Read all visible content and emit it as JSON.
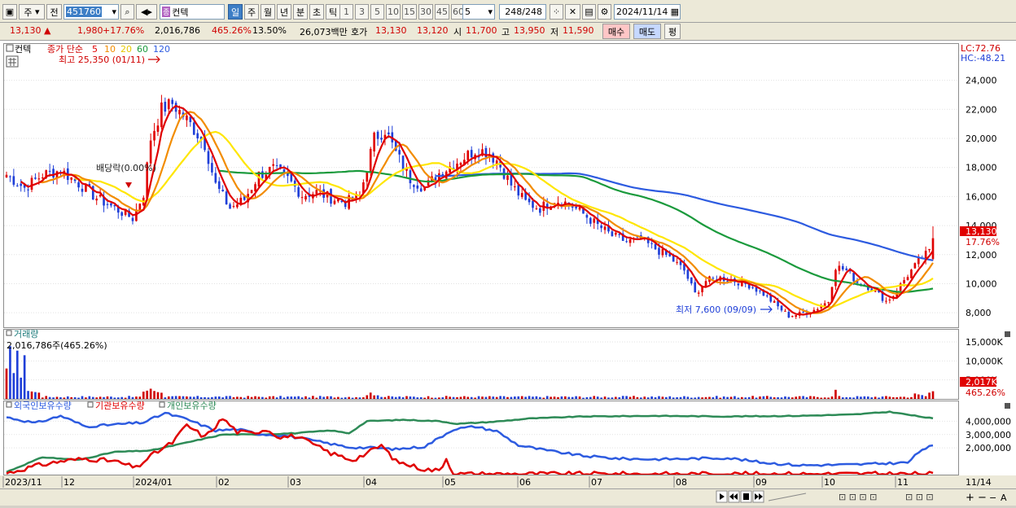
{
  "toolbar": {
    "market_sel": "주",
    "prev_btn": "전",
    "code": "451760",
    "name": "컨텍",
    "period_tabs": [
      "일",
      "주",
      "월",
      "년",
      "분",
      "초",
      "틱"
    ],
    "active_period": "일",
    "minute_buttons": [
      "1",
      "3",
      "5",
      "10",
      "15",
      "30",
      "45",
      "60"
    ],
    "n_value": "5",
    "count": "248/248",
    "date": "2024/11/14"
  },
  "quote": {
    "price": "13,130",
    "arrow": "▲",
    "change": "1,980",
    "rate": "+17.76%",
    "volume": "2,016,786",
    "vol_ratio": "465.26%",
    "turnover": "13.50%",
    "amount": "26,073백만",
    "ask_label": "호가",
    "ask1": "13,130",
    "ask2": "13,120",
    "open_label": "시",
    "open": "11,700",
    "high_label": "고",
    "high": "13,950",
    "low_label": "저",
    "low": "11,590",
    "buy_label": "매수",
    "sell_label": "매도",
    "avg_label": "평"
  },
  "colors": {
    "up": "#e00000",
    "down": "#1f3fd8",
    "ma5": "#e00000",
    "ma10": "#f28c00",
    "ma20": "#ffe600",
    "ma60": "#1a9a3c",
    "ma120": "#2d5be0",
    "volume_up": "#d00000",
    "volume_down": "#1f3fd8",
    "foreign": "#2d5be0",
    "institution": "#e00000",
    "individual": "#2e8b57"
  },
  "chart_data": [
    {
      "type": "candlestick",
      "panel": "price",
      "ylim": [
        7000,
        26500
      ],
      "yticks": [
        8000,
        10000,
        12000,
        14000,
        16000,
        18000,
        20000,
        22000,
        24000
      ],
      "ytick_labels": [
        "8,000",
        "10,000",
        "12,000",
        "14,000",
        "16,000",
        "18,000",
        "20,000",
        "22,000",
        "24,000"
      ],
      "legend": {
        "name": "컨텍",
        "series_label": "종가 단순",
        "ma_periods": [
          "5",
          "10",
          "20",
          "60",
          "120"
        ]
      },
      "right_labels": {
        "lc": "LC:72.76",
        "hc": "HC:-48.21",
        "last_price": "13,130",
        "last_rate": "17.76%"
      },
      "annotations": {
        "high": "최고 25,350 (01/11)",
        "low": "최저 7,600 (09/09)",
        "dividend": "배당락(0.00%)"
      },
      "x_axis": [
        "2023/11",
        "12",
        "2024/01",
        "02",
        "03",
        "04",
        "05",
        "06",
        "07",
        "08",
        "09",
        "10",
        "11",
        "11/14"
      ],
      "close_waypoints": [
        [
          0,
          17500
        ],
        [
          5,
          16600
        ],
        [
          10,
          17500
        ],
        [
          15,
          17800
        ],
        [
          20,
          16900
        ],
        [
          25,
          15900
        ],
        [
          30,
          15200
        ],
        [
          35,
          14500
        ],
        [
          38,
          16200
        ],
        [
          40,
          20000
        ],
        [
          43,
          22000
        ],
        [
          46,
          22400
        ],
        [
          50,
          21300
        ],
        [
          55,
          19600
        ],
        [
          58,
          16800
        ],
        [
          62,
          15200
        ],
        [
          66,
          15800
        ],
        [
          70,
          17500
        ],
        [
          74,
          17900
        ],
        [
          78,
          17200
        ],
        [
          82,
          16100
        ],
        [
          86,
          16300
        ],
        [
          90,
          15900
        ],
        [
          94,
          15600
        ],
        [
          98,
          16000
        ],
        [
          102,
          20000
        ],
        [
          105,
          20600
        ],
        [
          108,
          19000
        ],
        [
          112,
          17200
        ],
        [
          116,
          16600
        ],
        [
          120,
          17600
        ],
        [
          125,
          18400
        ],
        [
          130,
          19200
        ],
        [
          133,
          19100
        ],
        [
          136,
          18500
        ],
        [
          140,
          16800
        ],
        [
          144,
          15600
        ],
        [
          148,
          15200
        ],
        [
          152,
          15800
        ],
        [
          156,
          15500
        ],
        [
          160,
          14800
        ],
        [
          164,
          14000
        ],
        [
          168,
          13300
        ],
        [
          172,
          12900
        ],
        [
          176,
          13000
        ],
        [
          180,
          12400
        ],
        [
          184,
          11800
        ],
        [
          188,
          10900
        ],
        [
          191,
          9300
        ],
        [
          194,
          10200
        ],
        [
          198,
          10400
        ],
        [
          202,
          10200
        ],
        [
          206,
          9900
        ],
        [
          210,
          9300
        ],
        [
          214,
          8400
        ],
        [
          217,
          7800
        ],
        [
          220,
          7900
        ],
        [
          224,
          8200
        ],
        [
          228,
          8800
        ],
        [
          230,
          11200
        ],
        [
          233,
          10900
        ],
        [
          236,
          10100
        ],
        [
          240,
          9700
        ],
        [
          244,
          8800
        ],
        [
          246,
          9200
        ],
        [
          250,
          10600
        ],
        [
          254,
          11800
        ],
        [
          256,
          12200
        ],
        [
          257,
          13130
        ]
      ],
      "ma60_start_index": 60,
      "ma120_start_index": 120,
      "candle_count": 258
    },
    {
      "type": "bar",
      "panel": "volume",
      "title": "거래량",
      "value_label": "2,016,786주(465.26%)",
      "ylim": [
        0,
        18000
      ],
      "yticks": [
        5000,
        10000,
        15000
      ],
      "ytick_labels": [
        "5,000K",
        "10,000K",
        "15,000K"
      ],
      "right_labels": {
        "value": "2,017K",
        "ratio": "465.26%"
      },
      "last_value": 2017
    },
    {
      "type": "line",
      "panel": "holdings",
      "series": [
        {
          "name": "외국인보유수량"
        },
        {
          "name": "기관보유수량"
        },
        {
          "name": "개인보유수량"
        }
      ],
      "ylim": [
        0,
        5300000
      ],
      "yticks": [
        2000000,
        3000000,
        4000000
      ],
      "ytick_labels": [
        "2,000,000",
        "3,000,000",
        "4,000,000"
      ],
      "foreign": [
        [
          0,
          4300000
        ],
        [
          8,
          3850000
        ],
        [
          15,
          4400000
        ],
        [
          22,
          3600000
        ],
        [
          30,
          3750000
        ],
        [
          38,
          3900000
        ],
        [
          44,
          4600000
        ],
        [
          50,
          4150000
        ],
        [
          58,
          3300000
        ],
        [
          64,
          3400000
        ],
        [
          70,
          3050000
        ],
        [
          78,
          2900000
        ],
        [
          86,
          2500000
        ],
        [
          95,
          2050000
        ],
        [
          102,
          2000000
        ],
        [
          108,
          1900000
        ],
        [
          116,
          2100000
        ],
        [
          124,
          3400000
        ],
        [
          130,
          3600000
        ],
        [
          136,
          3250000
        ],
        [
          142,
          2200000
        ],
        [
          150,
          1800000
        ],
        [
          160,
          1400000
        ],
        [
          170,
          1200000
        ],
        [
          180,
          1150000
        ],
        [
          190,
          1200000
        ],
        [
          200,
          1250000
        ],
        [
          210,
          900000
        ],
        [
          220,
          700000
        ],
        [
          235,
          750000
        ],
        [
          250,
          900000
        ],
        [
          254,
          1900000
        ],
        [
          257,
          2150000
        ]
      ],
      "institution": [
        [
          0,
          100000
        ],
        [
          8,
          650000
        ],
        [
          15,
          1000000
        ],
        [
          22,
          1200000
        ],
        [
          30,
          1000000
        ],
        [
          36,
          500000
        ],
        [
          40,
          1400000
        ],
        [
          46,
          2400000
        ],
        [
          50,
          3700000
        ],
        [
          55,
          2800000
        ],
        [
          60,
          4200000
        ],
        [
          64,
          3200000
        ],
        [
          68,
          3100000
        ],
        [
          72,
          3400000
        ],
        [
          76,
          2800000
        ],
        [
          80,
          2900000
        ],
        [
          84,
          2400000
        ],
        [
          90,
          1600000
        ],
        [
          96,
          1100000
        ],
        [
          100,
          1600000
        ],
        [
          104,
          2200000
        ],
        [
          108,
          1000000
        ],
        [
          112,
          700000
        ],
        [
          116,
          400000
        ],
        [
          120,
          300000
        ],
        [
          122,
          1200000
        ],
        [
          124,
          50000
        ],
        [
          257,
          50000
        ]
      ],
      "individual": [
        [
          0,
          200000
        ],
        [
          10,
          1300000
        ],
        [
          20,
          1100000
        ],
        [
          30,
          1700000
        ],
        [
          40,
          1800000
        ],
        [
          50,
          2400000
        ],
        [
          60,
          3000000
        ],
        [
          70,
          3000000
        ],
        [
          80,
          3100000
        ],
        [
          90,
          3300000
        ],
        [
          95,
          3100000
        ],
        [
          100,
          4000000
        ],
        [
          110,
          4100000
        ],
        [
          120,
          4000000
        ],
        [
          125,
          3800000
        ],
        [
          135,
          3950000
        ],
        [
          145,
          4200000
        ],
        [
          160,
          4350000
        ],
        [
          180,
          4400000
        ],
        [
          200,
          4350000
        ],
        [
          220,
          4400000
        ],
        [
          235,
          4500000
        ],
        [
          245,
          4700000
        ],
        [
          252,
          4400000
        ],
        [
          257,
          4200000
        ]
      ]
    }
  ],
  "bottom_icons": [
    "play-icon",
    "rewind-icon",
    "stop-icon",
    "fast-forward-icon",
    "plus-icon",
    "minus-icon",
    "zoom-icon"
  ]
}
